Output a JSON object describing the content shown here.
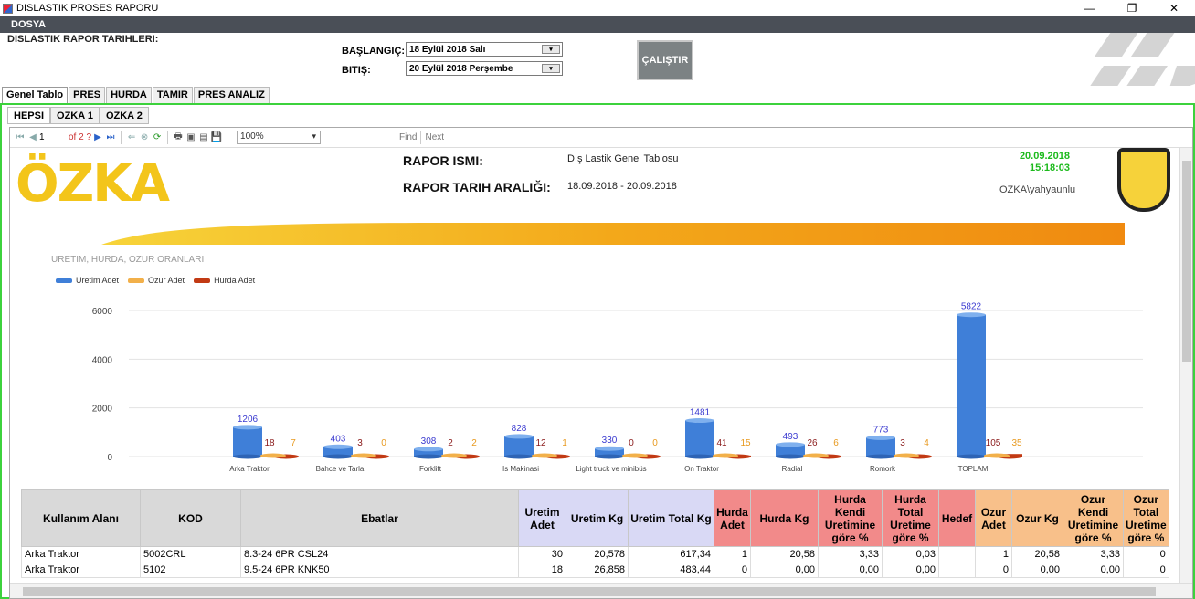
{
  "window": {
    "title": "DISLASTIK PROSES RAPORU",
    "minimize": "—",
    "maximize": "❐",
    "close": "✕"
  },
  "menu": {
    "items": [
      "DOSYA"
    ]
  },
  "header": {
    "section_label": "DISLASTIK RAPOR TARIHLERI:",
    "start_label": "BAŞLANGIÇ:",
    "end_label": "BITIŞ:",
    "start_date": "18   Eylül    2018       Salı",
    "end_date": "20   Eylül    2018  Perşembe",
    "run_button": "ÇALIŞTIR"
  },
  "tabs_outer": [
    "Genel Tablo",
    "PRES",
    "HURDA",
    "TAMIR",
    "PRES ANALIZ"
  ],
  "tabs_inner": [
    "HEPSI",
    "OZKA 1",
    "OZKA 2"
  ],
  "toolbar": {
    "page": "1",
    "of_pages": "of  2 ?",
    "zoom": "100%",
    "find": "Find",
    "next": "Next"
  },
  "report": {
    "logo": "ÖZKA",
    "name_label": "RAPOR ISMI:",
    "name_value": "Dış Lastik Genel Tablosu",
    "range_label": "RAPOR TARIH ARALIĞI:",
    "range_value": "18.09.2018    - 20.09.2018",
    "print_date": "20.09.2018",
    "print_time": "15:18:03",
    "user": "OZKA\\yahyaunlu"
  },
  "chart_data": {
    "type": "bar",
    "title": "URETIM, HURDA, OZUR ORANLARI",
    "categories": [
      "Arka Traktor",
      "Bahce ve Tarla",
      "Forklift",
      "Is Makinasi",
      "Light truck ve minibüs",
      "On Traktor",
      "Radial",
      "Romork",
      "TOPLAM"
    ],
    "series": [
      {
        "name": "Uretim Adet",
        "color": "#3f7fd8",
        "label_color": "#3a3ad0",
        "values": [
          1206,
          403,
          308,
          828,
          330,
          1481,
          493,
          773,
          5822
        ]
      },
      {
        "name": "Ozur Adet",
        "color": "#f2b04a",
        "label_color": "#e89a20",
        "values": [
          7,
          0,
          2,
          1,
          0,
          15,
          6,
          4,
          35
        ]
      },
      {
        "name": "Hurda Adet",
        "color": "#c23a14",
        "label_color": "#8a1a1a",
        "values": [
          18,
          3,
          2,
          12,
          0,
          41,
          26,
          3,
          105
        ]
      }
    ],
    "y_ticks": [
      "6000",
      "4000",
      "2000",
      "0"
    ],
    "ylim": [
      0,
      6000
    ],
    "legend": "top-left"
  },
  "table": {
    "headers": [
      "Kullanım Alanı",
      "KOD",
      "Ebatlar",
      "Uretim Adet",
      "Uretim Kg",
      "Uretim Total Kg",
      "Hurda Adet",
      "Hurda Kg",
      "Hurda Kendi Uretimine göre %",
      "Hurda Total Uretime göre %",
      "Hedef",
      "Ozur Adet",
      "Ozur Kg",
      "Ozur Kendi Uretimine göre %",
      "Ozur Total Uretime göre %"
    ],
    "rows": [
      [
        "Arka Traktor",
        "5002CRL",
        "8.3-24 6PR CSL24",
        "30",
        "20,578",
        "617,34",
        "1",
        "20,58",
        "3,33",
        "0,03",
        "",
        "1",
        "20,58",
        "3,33",
        "0"
      ],
      [
        "Arka Traktor",
        "5102",
        "9.5-24 6PR KNK50",
        "18",
        "26,858",
        "483,44",
        "0",
        "0,00",
        "0,00",
        "0,00",
        "",
        "0",
        "0,00",
        "0,00",
        "0"
      ]
    ]
  }
}
